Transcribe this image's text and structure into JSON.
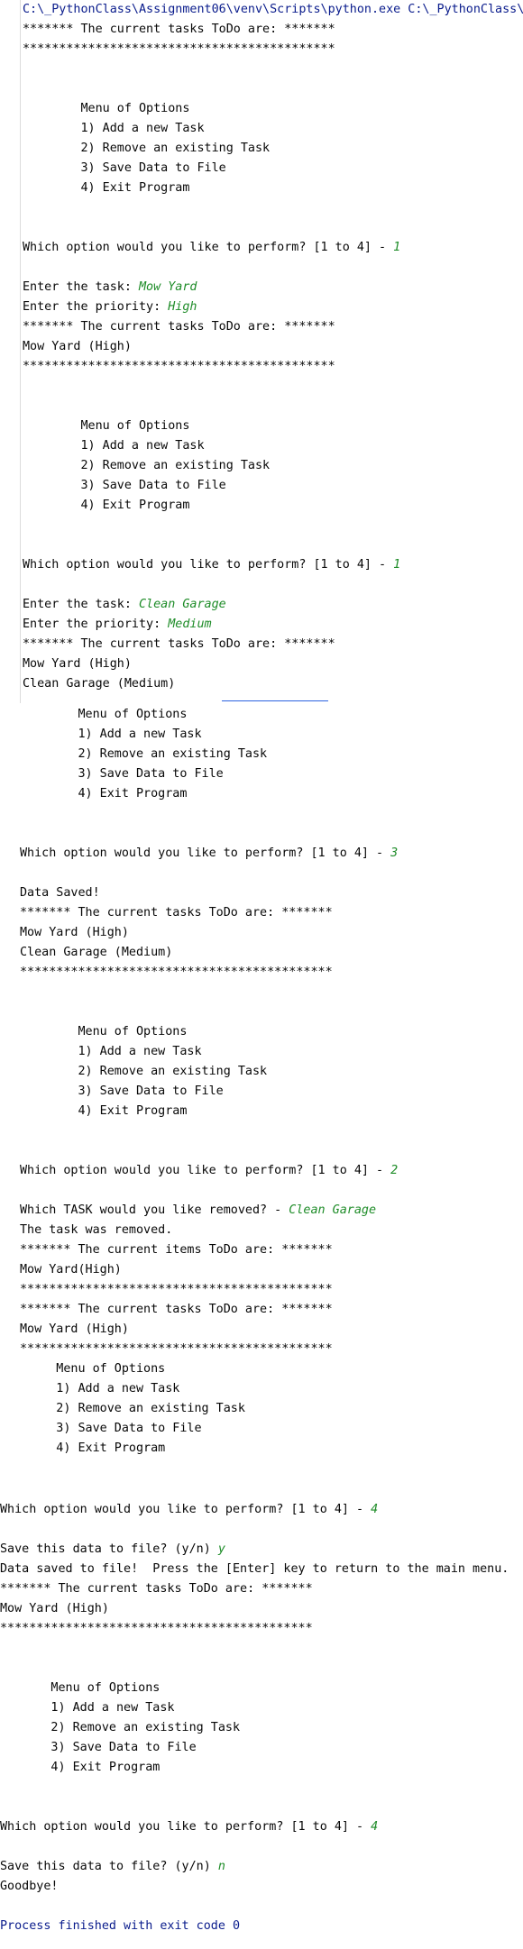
{
  "colors": {
    "output": "#080808",
    "command": "#0a1c8c",
    "user_input": "#1e8c28",
    "cursor_line": "#2a62e0"
  },
  "seg1": [
    {
      "t": "C:\\_PythonClass\\Assignment06\\venv\\Scripts\\python.exe C:\\_PythonClass\\",
      "s": "blue"
    },
    {
      "t": "******* The current tasks ToDo are: *******"
    },
    {
      "t": "*******************************************"
    },
    {
      "t": ""
    },
    {
      "t": ""
    },
    {
      "t": "        Menu of Options"
    },
    {
      "t": "        1) Add a new Task"
    },
    {
      "t": "        2) Remove an existing Task"
    },
    {
      "t": "        3) Save Data to File"
    },
    {
      "t": "        4) Exit Program"
    },
    {
      "t": ""
    },
    {
      "t": ""
    },
    {
      "t": "Which option would you like to perform? [1 to 4] - ",
      "i": "1"
    },
    {
      "t": ""
    },
    {
      "t": "Enter the task: ",
      "i": "Mow Yard"
    },
    {
      "t": "Enter the priority: ",
      "i": "High"
    },
    {
      "t": "******* The current tasks ToDo are: *******"
    },
    {
      "t": "Mow Yard (High)"
    },
    {
      "t": "*******************************************"
    },
    {
      "t": ""
    },
    {
      "t": ""
    },
    {
      "t": "        Menu of Options"
    },
    {
      "t": "        1) Add a new Task"
    },
    {
      "t": "        2) Remove an existing Task"
    },
    {
      "t": "        3) Save Data to File"
    },
    {
      "t": "        4) Exit Program"
    },
    {
      "t": ""
    },
    {
      "t": ""
    },
    {
      "t": "Which option would you like to perform? [1 to 4] - ",
      "i": "1"
    },
    {
      "t": ""
    },
    {
      "t": "Enter the task: ",
      "i": "Clean Garage"
    },
    {
      "t": "Enter the priority: ",
      "i": "Medium"
    },
    {
      "t": "******* The current tasks ToDo are: *******"
    },
    {
      "t": "Mow Yard (High)"
    },
    {
      "t": "Clean Garage (Medium)"
    }
  ],
  "seg2": [
    {
      "t": "        Menu of Options"
    },
    {
      "t": "        1) Add a new Task"
    },
    {
      "t": "        2) Remove an existing Task"
    },
    {
      "t": "        3) Save Data to File"
    },
    {
      "t": "        4) Exit Program"
    },
    {
      "t": ""
    },
    {
      "t": ""
    },
    {
      "t": "Which option would you like to perform? [1 to 4] - ",
      "i": "3"
    },
    {
      "t": ""
    },
    {
      "t": "Data Saved!"
    },
    {
      "t": "******* The current tasks ToDo are: *******"
    },
    {
      "t": "Mow Yard (High)"
    },
    {
      "t": "Clean Garage (Medium)"
    },
    {
      "t": "*******************************************"
    },
    {
      "t": ""
    },
    {
      "t": ""
    },
    {
      "t": "        Menu of Options"
    },
    {
      "t": "        1) Add a new Task"
    },
    {
      "t": "        2) Remove an existing Task"
    },
    {
      "t": "        3) Save Data to File"
    },
    {
      "t": "        4) Exit Program"
    },
    {
      "t": ""
    },
    {
      "t": ""
    },
    {
      "t": "Which option would you like to perform? [1 to 4] - ",
      "i": "2"
    },
    {
      "t": ""
    },
    {
      "t": "Which TASK would you like removed? - ",
      "i": "Clean Garage"
    },
    {
      "t": "The task was removed."
    },
    {
      "t": "******* The current items ToDo are: *******"
    },
    {
      "t": "Mow Yard(High)"
    },
    {
      "t": "*******************************************"
    },
    {
      "t": "******* The current tasks ToDo are: *******"
    },
    {
      "t": "Mow Yard (High)"
    },
    {
      "t": "*******************************************"
    },
    {
      "t": "     Menu of Options",
      "x": 0
    },
    {
      "t": "     1) Add a new Task",
      "x": 0
    },
    {
      "t": "     2) Remove an existing Task",
      "x": 0
    },
    {
      "t": "     3) Save Data to File",
      "x": 0
    },
    {
      "t": "     4) Exit Program",
      "x": 0
    }
  ],
  "seg3": [
    {
      "t": ""
    },
    {
      "t": "Which option would you like to perform? [1 to 4] - ",
      "i": "4"
    },
    {
      "t": ""
    },
    {
      "t": "Save this data to file? (y/n) ",
      "i": "y"
    },
    {
      "t": "Data saved to file!  Press the [Enter] key to return to the main menu."
    },
    {
      "t": "******* The current tasks ToDo are: *******"
    },
    {
      "t": "Mow Yard (High)"
    },
    {
      "t": "*******************************************"
    },
    {
      "t": ""
    },
    {
      "t": ""
    },
    {
      "t": "       Menu of Options"
    },
    {
      "t": "       1) Add a new Task"
    },
    {
      "t": "       2) Remove an existing Task"
    },
    {
      "t": "       3) Save Data to File"
    },
    {
      "t": "       4) Exit Program"
    },
    {
      "t": ""
    },
    {
      "t": ""
    },
    {
      "t": "Which option would you like to perform? [1 to 4] - ",
      "i": "4"
    },
    {
      "t": ""
    },
    {
      "t": "Save this data to file? (y/n) ",
      "i": "n"
    },
    {
      "t": "Goodbye!"
    },
    {
      "t": ""
    },
    {
      "t": "Process finished with exit code 0",
      "s": "blue"
    }
  ]
}
